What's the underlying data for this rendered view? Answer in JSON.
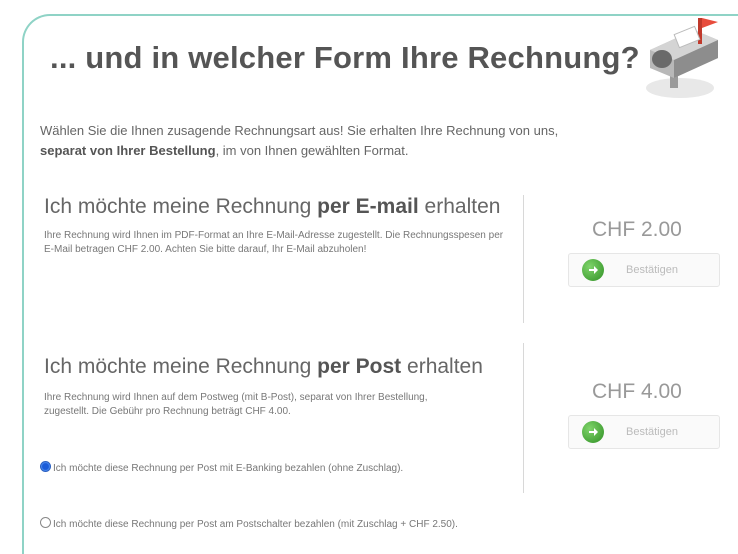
{
  "header": {
    "title": "... und in welcher Form Ihre Rechnung?",
    "icon": "mailbox-icon"
  },
  "intro": {
    "text_before": "Wählen Sie die Ihnen zusagende Rechnungsart aus! Sie erhalten Ihre Rechnung von uns,",
    "bold": "separat von Ihrer Bestellung",
    "text_after": ", im von Ihnen gewählten Format."
  },
  "email_option": {
    "title_pre": "Ich möchte meine Rechnung ",
    "title_bold": "per E-mail",
    "title_post": " erhalten",
    "description": "Ihre Rechnung wird Ihnen im PDF-Format an Ihre E-Mail-Adresse zugestellt. Die Rechnungsspesen per E-Mail betragen CHF 2.00. Achten Sie bitte darauf, Ihr E-Mail abzuholen!",
    "price": "CHF 2.00",
    "confirm_label": "Bestätigen"
  },
  "post_option": {
    "title_pre": "Ich möchte meine Rechnung ",
    "title_bold": "per Post",
    "title_post": " erhalten",
    "description": "Ihre Rechnung wird Ihnen auf dem Postweg (mit B-Post), separat von Ihrer Bestellung, zugestellt. Die Gebühr pro Rechnung beträgt CHF 4.00.",
    "price": "CHF 4.00",
    "confirm_label": "Bestätigen",
    "radios": [
      {
        "label": "Ich möchte diese Rechnung per Post mit E-Banking bezahlen (ohne Zuschlag).",
        "selected": true
      },
      {
        "label": "Ich möchte diese Rechnung per Post am Postschalter bezahlen (mit Zuschlag + CHF 2.50).",
        "selected": false
      }
    ]
  },
  "colors": {
    "border_accent": "#8fd3c6",
    "confirm_arrow": "#2f8f24",
    "radio_selected": "#1a5bd8"
  }
}
